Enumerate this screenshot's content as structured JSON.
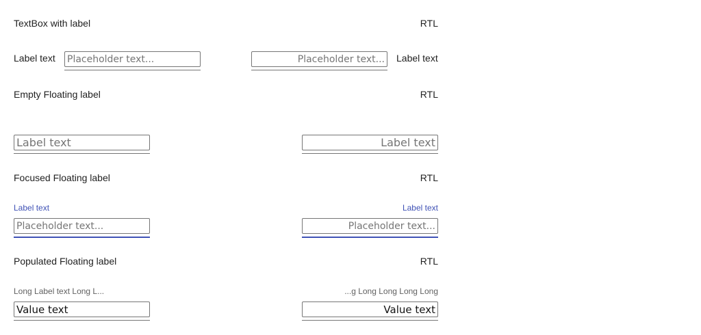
{
  "sections": {
    "with_label": {
      "heading": "TextBox with label",
      "rtl_tag": "RTL",
      "ltr": {
        "label": "Label text",
        "placeholder": "Placeholder text..."
      },
      "rtl": {
        "label": "Label text",
        "placeholder": "...Placeholder text"
      }
    },
    "empty_floating": {
      "heading": "Empty Floating label",
      "rtl_tag": "RTL",
      "ltr": {
        "placeholder": "Label text"
      },
      "rtl": {
        "placeholder": "Label text"
      }
    },
    "focused_floating": {
      "heading": "Focused Floating label",
      "rtl_tag": "RTL",
      "ltr": {
        "label": "Label text",
        "placeholder": "Placeholder text..."
      },
      "rtl": {
        "label": "Label text",
        "placeholder": "...Placeholder text"
      }
    },
    "populated_floating": {
      "heading": "Populated Floating label",
      "rtl_tag": "RTL",
      "ltr": {
        "label": "Long Label text Long L...",
        "value": "Value text"
      },
      "rtl": {
        "label": "...g Long Long Long Long",
        "value": "Value text"
      }
    }
  },
  "colors": {
    "focus_accent": "#3f51b5",
    "border": "#757575"
  }
}
